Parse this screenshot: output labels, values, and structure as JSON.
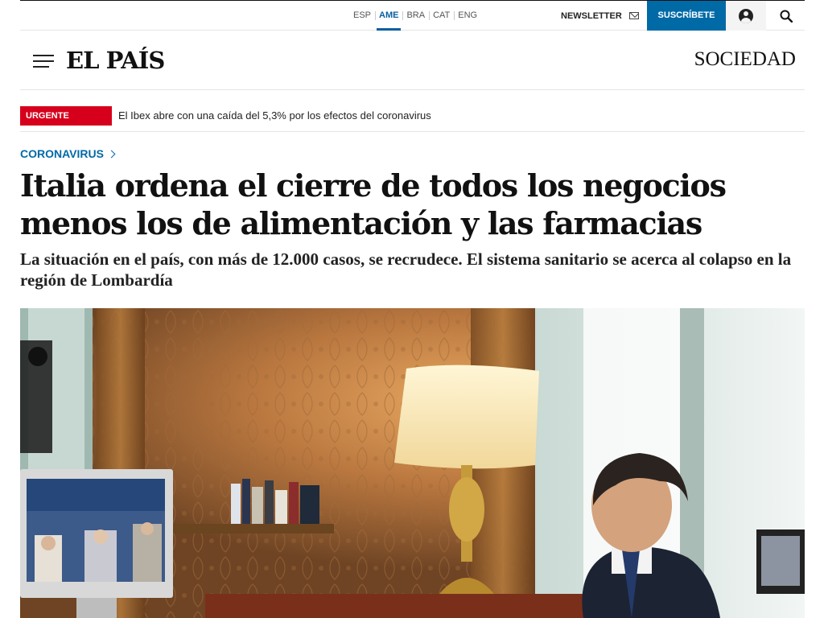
{
  "topbar": {
    "languages": [
      "ESP",
      "AME",
      "BRA",
      "CAT",
      "ENG"
    ],
    "active_language": "AME",
    "newsletter_label": "NEWSLETTER",
    "subscribe_label": "SUSCRÍBETE"
  },
  "masthead": {
    "logo": "EL PAÍS",
    "section": "SOCIEDAD"
  },
  "breaking": {
    "badge": "URGENTE",
    "text": "El Ibex abre con una caída del 5,3% por los efectos del coronavirus"
  },
  "article": {
    "kicker": "CORONAVIRUS",
    "headline": "Italia ordena el cierre de todos los negocios menos los de alimentación y las farmacias",
    "subtitle": "La situación en el país, con más de 12.000 casos, se recrudece. El sistema sanitario se acerca al colapso en la región de Lombardía"
  },
  "colors": {
    "accent_blue": "#006aa7",
    "urgent_red": "#d6001c"
  },
  "icons": [
    "menu-icon",
    "envelope-icon",
    "user-icon",
    "search-icon",
    "chevron-right-icon"
  ]
}
